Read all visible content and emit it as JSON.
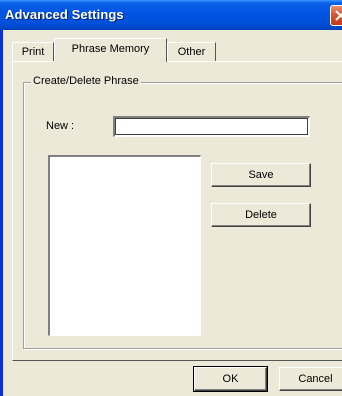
{
  "window": {
    "title": "Advanced Settings"
  },
  "tabs": [
    {
      "label": "Print",
      "active": false
    },
    {
      "label": "Phrase Memory",
      "active": true
    },
    {
      "label": "Other",
      "active": false
    }
  ],
  "group": {
    "label": "Create/Delete Phrase",
    "new_label": "New :",
    "new_value": "",
    "phrase_list": [],
    "save_label": "Save",
    "delete_label": "Delete"
  },
  "footer": {
    "ok_label": "OK",
    "cancel_label": "Cancel"
  },
  "colors": {
    "titlebar": "#0054e3",
    "dialog_bg": "#ece9d8",
    "close_button": "#d5522f"
  },
  "icons": {
    "close": "close-icon"
  }
}
